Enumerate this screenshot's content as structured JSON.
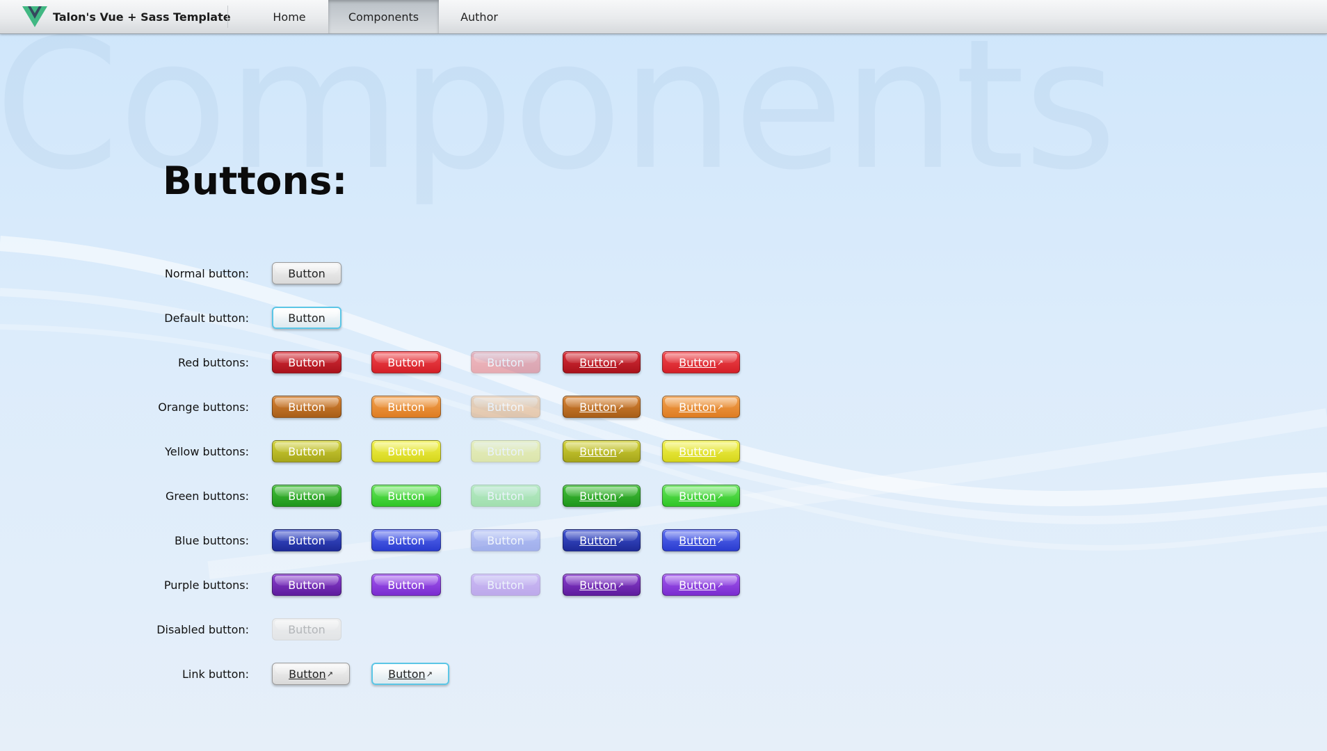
{
  "header": {
    "brand_title": "Talon's Vue + Sass Template",
    "nav": [
      {
        "label": "Home",
        "active": false
      },
      {
        "label": "Components",
        "active": true
      },
      {
        "label": "Author",
        "active": false
      }
    ]
  },
  "background_word": "Components",
  "heading": "Buttons:",
  "rows": [
    {
      "label": "Normal button:",
      "buttons": [
        "Button"
      ]
    },
    {
      "label": "Default button:",
      "buttons": [
        "Button"
      ]
    },
    {
      "label": "Red buttons:",
      "buttons": [
        "Button",
        "Button",
        "Button",
        "Button",
        "Button"
      ]
    },
    {
      "label": "Orange buttons:",
      "buttons": [
        "Button",
        "Button",
        "Button",
        "Button",
        "Button"
      ]
    },
    {
      "label": "Yellow buttons:",
      "buttons": [
        "Button",
        "Button",
        "Button",
        "Button",
        "Button"
      ]
    },
    {
      "label": "Green buttons:",
      "buttons": [
        "Button",
        "Button",
        "Button",
        "Button",
        "Button"
      ]
    },
    {
      "label": "Blue buttons:",
      "buttons": [
        "Button",
        "Button",
        "Button",
        "Button",
        "Button"
      ]
    },
    {
      "label": "Purple buttons:",
      "buttons": [
        "Button",
        "Button",
        "Button",
        "Button",
        "Button"
      ]
    },
    {
      "label": "Disabled button:",
      "buttons": [
        "Button"
      ]
    },
    {
      "label": "Link button:",
      "buttons": [
        "Button",
        "Button"
      ]
    }
  ],
  "colors": {
    "red": "#e0242b",
    "red_dark": "#b5121c",
    "orange": "#e9882a",
    "orange_dark": "#c06a1c",
    "yellow": "#e3e32a",
    "yellow_dark": "#b8b81e",
    "green": "#3fd431",
    "green_dark": "#27ad23",
    "blue": "#3346d6",
    "blue_dark": "#2330a8",
    "purple": "#8a34d6",
    "purple_dark": "#6a22ab",
    "default_accent": "#5bc6e6"
  },
  "icons": {
    "external_link": "external-link-icon",
    "logo": "vue-logo-icon"
  }
}
